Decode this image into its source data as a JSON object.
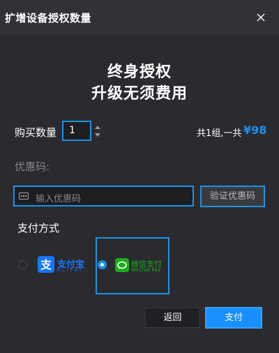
{
  "dialog": {
    "title": "扩增设备授权数量",
    "close_icon": "close-icon"
  },
  "headline": {
    "line1": "终身授权",
    "line2": "升级无须费用"
  },
  "quantity": {
    "label": "购买数量",
    "value": "1"
  },
  "summary": {
    "text": "共1组,一共",
    "price": "¥98"
  },
  "coupon": {
    "label": "优惠码:",
    "placeholder": "输入优惠码",
    "verify_label": "验证优惠码"
  },
  "payment": {
    "label": "支付方式",
    "methods": [
      {
        "name": "alipay",
        "text": "支付宝",
        "sub": "ALIPAY",
        "selected": false,
        "color": "#1677ff"
      },
      {
        "name": "wechat",
        "text": "微信支付",
        "sub": "WeChat Pay",
        "selected": true,
        "color": "#1aad19"
      }
    ]
  },
  "actions": {
    "back_label": "返回",
    "pay_label": "支付"
  },
  "colors": {
    "accent": "#1b93e6",
    "background": "#2b2b2f",
    "price": "#1e8ff0"
  }
}
